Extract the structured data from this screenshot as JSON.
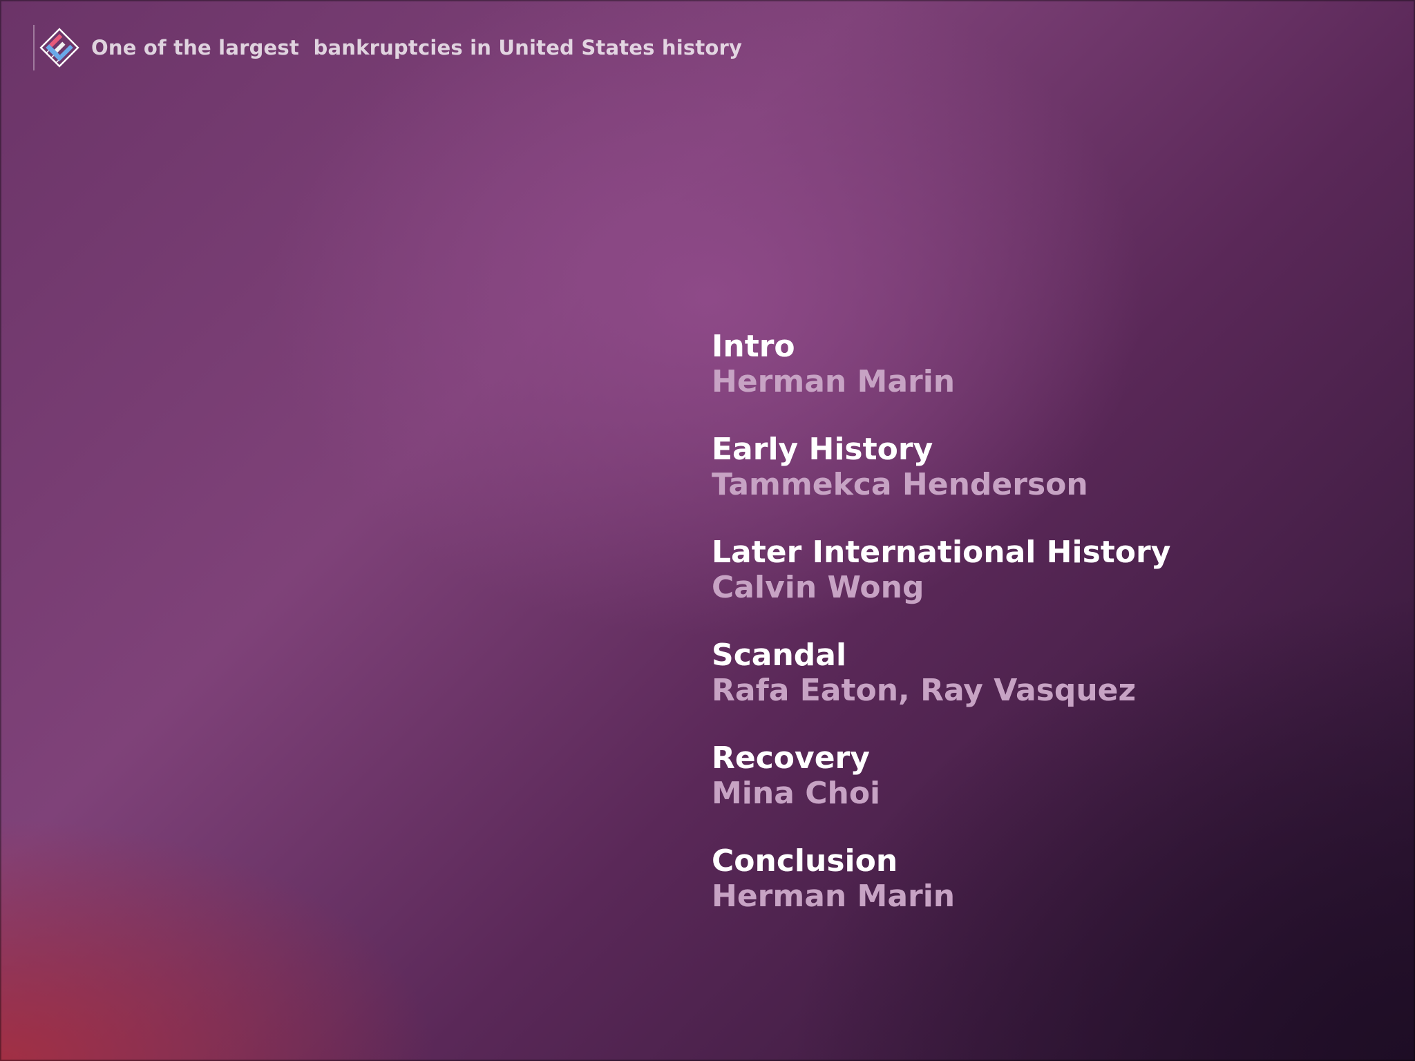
{
  "header": {
    "logo_icon": "tilted-e-logo-icon",
    "title": "One of the largest  bankruptcies in United States history"
  },
  "agenda": [
    {
      "title": "Intro",
      "presenter": "Herman Marin"
    },
    {
      "title": "Early History",
      "presenter": "Tammekca Henderson"
    },
    {
      "title": "Later International History",
      "presenter": "Calvin Wong"
    },
    {
      "title": "Scandal",
      "presenter": "Rafa Eaton, Ray Vasquez"
    },
    {
      "title": "Recovery",
      "presenter": "Mina Choi"
    },
    {
      "title": "Conclusion",
      "presenter": "Herman Marin"
    }
  ],
  "colors": {
    "title_text": "#ffffff",
    "presenter_text": "#c7a3c4",
    "background_mid": "#7f4279",
    "background_dark": "#2b1432",
    "accent_red": "#aa2d3c"
  }
}
